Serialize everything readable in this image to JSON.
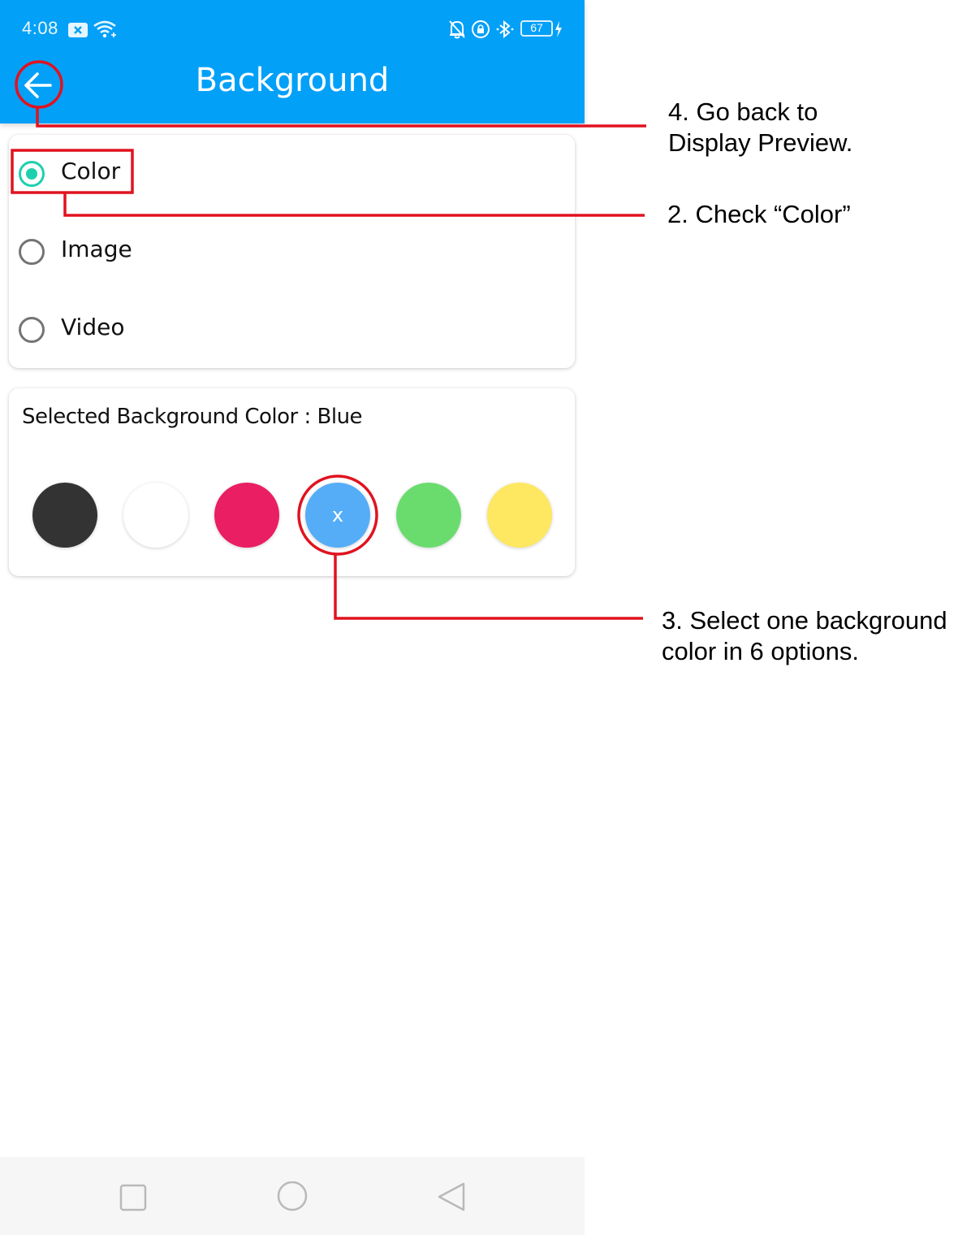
{
  "status_bar": {
    "time": "4:08",
    "battery": "67"
  },
  "header": {
    "title": "Background",
    "back_icon": "arrow-left-icon"
  },
  "background_type": {
    "options": [
      {
        "label": "Color",
        "selected": true
      },
      {
        "label": "Image",
        "selected": false
      },
      {
        "label": "Video",
        "selected": false
      }
    ]
  },
  "color_picker": {
    "selected_label": "Selected Background Color : Blue",
    "swatches": [
      {
        "name": "black",
        "color": "#333333",
        "mark": ""
      },
      {
        "name": "white",
        "color": "#FFFFFF",
        "mark": ""
      },
      {
        "name": "pink",
        "color": "#E91E63",
        "mark": ""
      },
      {
        "name": "blue",
        "color": "#55ADF7",
        "mark": "x"
      },
      {
        "name": "green",
        "color": "#6ADC6E",
        "mark": ""
      },
      {
        "name": "yellow",
        "color": "#FEE761",
        "mark": ""
      }
    ]
  },
  "nav_bar": {
    "icons": [
      "square-recents-icon",
      "circle-home-icon",
      "triangle-back-icon"
    ]
  },
  "annotations": {
    "back": {
      "line1": "4. Go back to",
      "line2": "Display Preview."
    },
    "color": {
      "line1": "2. Check “Color”"
    },
    "swatch": {
      "line1": "3. Select one background",
      "line2": "color in 6 options."
    }
  },
  "colors": {
    "app_bar": "#03A0F8",
    "radio_accent": "#1ECFAE",
    "annotation_red": "#E0131F"
  }
}
